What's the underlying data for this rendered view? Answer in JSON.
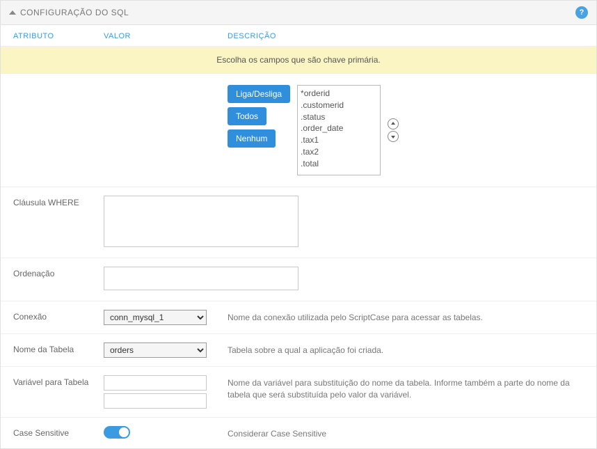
{
  "panel": {
    "title": "CONFIGURAÇÃO DO SQL"
  },
  "columns": {
    "attribute": "ATRIBUTO",
    "value": "VALOR",
    "description": "DESCRIÇÃO"
  },
  "hint": "Escolha os campos que são chave primária.",
  "pk": {
    "btn_toggle": "Liga/Desliga",
    "btn_all": "Todos",
    "btn_none": "Nenhum",
    "fields": [
      "*orderid",
      ".customerid",
      ".status",
      ".order_date",
      ".tax1",
      ".tax2",
      ".total"
    ]
  },
  "rows": {
    "where": {
      "label": "Cláusula WHERE",
      "value": ""
    },
    "order": {
      "label": "Ordenação",
      "value": ""
    },
    "conn": {
      "label": "Conexão",
      "selected": "conn_mysql_1",
      "desc": "Nome da conexão utilizada pelo ScriptCase para acessar as tabelas."
    },
    "table": {
      "label": "Nome da Tabela",
      "selected": "orders",
      "desc": "Tabela sobre a qual a aplicação foi criada."
    },
    "tablevar": {
      "label": "Variável para Tabela",
      "v1": "",
      "v2": "",
      "desc": "Nome da variável para substituição do nome da tabela. Informe também a parte do nome da tabela que será substituída pelo valor da variável."
    },
    "casesens": {
      "label": "Case Sensitive",
      "desc": "Considerar Case Sensitive"
    }
  }
}
